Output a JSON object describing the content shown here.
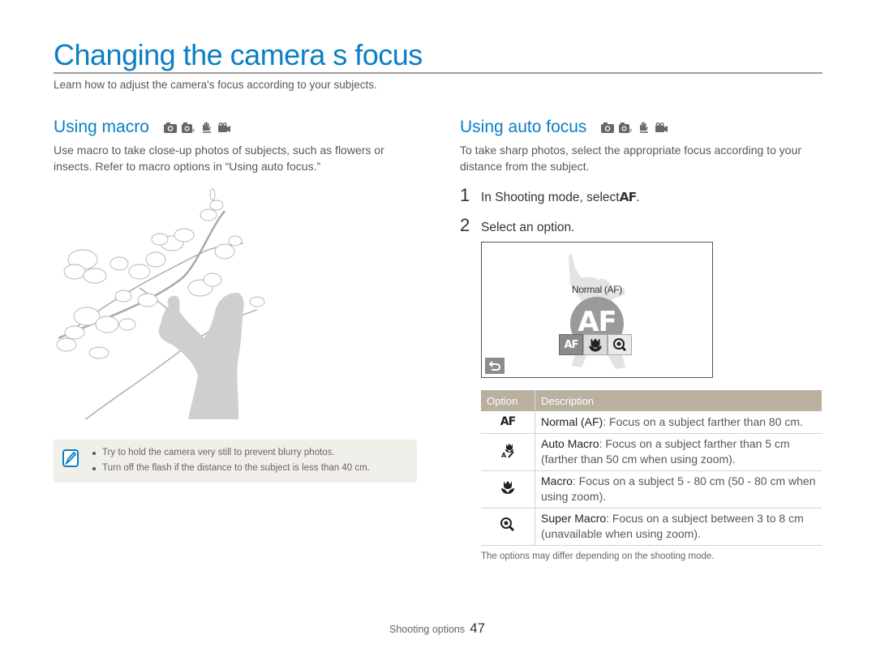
{
  "page": {
    "title": "Changing the camera s focus",
    "subtitle": "Learn how to adjust the camera's focus according to your subjects."
  },
  "macro_section": {
    "heading": "Using macro",
    "mode_icons": [
      "camera-auto-icon",
      "camera-program-icon",
      "dual-is-icon",
      "movie-icon"
    ],
    "body": "Use macro to take close-up photos of subjects, such as flowers or insects. Refer to macro options in “Using auto focus.”",
    "illustration": "woman-photographing-magnolia-branch",
    "note": {
      "icon": "note-pencil-icon",
      "items": [
        "Try to hold the camera very still to prevent blurry photos.",
        "Turn off the flash if the distance to the subject is less than 40 cm."
      ]
    }
  },
  "af_section": {
    "heading": "Using auto focus",
    "mode_icons": [
      "camera-auto-icon",
      "camera-program-icon",
      "dual-is-icon",
      "movie-icon"
    ],
    "body": "To take sharp photos, select the appropriate focus according to your distance from the subject.",
    "steps": [
      {
        "num": "1",
        "text": "In Shooting mode, select",
        "glyph": "AF",
        "suffix": "."
      },
      {
        "num": "2",
        "text": "Select an option.",
        "glyph": "",
        "suffix": ""
      }
    ],
    "screen": {
      "label": "Normal (AF)",
      "big_glyph": "AF",
      "options": [
        {
          "icon": "af-icon",
          "glyph": "AF",
          "selected": true
        },
        {
          "icon": "macro-tulip-icon",
          "glyph": "",
          "selected": false
        },
        {
          "icon": "super-macro-magnifier-icon",
          "glyph": "",
          "selected": false
        }
      ],
      "back_icon": "back-arrow-icon"
    },
    "table": {
      "headers": [
        "Option",
        "Description"
      ],
      "rows": [
        {
          "icon": "af-icon",
          "glyph": "AF",
          "name": "Normal (AF)",
          "desc": ": Focus on a subject farther than 80 cm."
        },
        {
          "icon": "auto-macro-icon",
          "glyph": "",
          "name": "Auto Macro",
          "desc": ": Focus on a subject farther than 5 cm (farther than 50 cm when using zoom)."
        },
        {
          "icon": "macro-tulip-icon",
          "glyph": "",
          "name": "Macro",
          "desc": ": Focus on a subject 5 - 80 cm (50 - 80 cm when using zoom)."
        },
        {
          "icon": "super-macro-magnifier-icon",
          "glyph": "",
          "name": "Super Macro",
          "desc": ": Focus on a subject between 3 to 8 cm (unavailable when using zoom)."
        }
      ]
    },
    "footnote": "The options may differ depending on the shooting mode."
  },
  "footer": {
    "section": "Shooting options",
    "page_number": "47"
  },
  "colors": {
    "accent": "#0a7fc4",
    "table_header": "#b9b09f",
    "note_bg": "#f1efea",
    "rule": "#a0a0a0"
  }
}
